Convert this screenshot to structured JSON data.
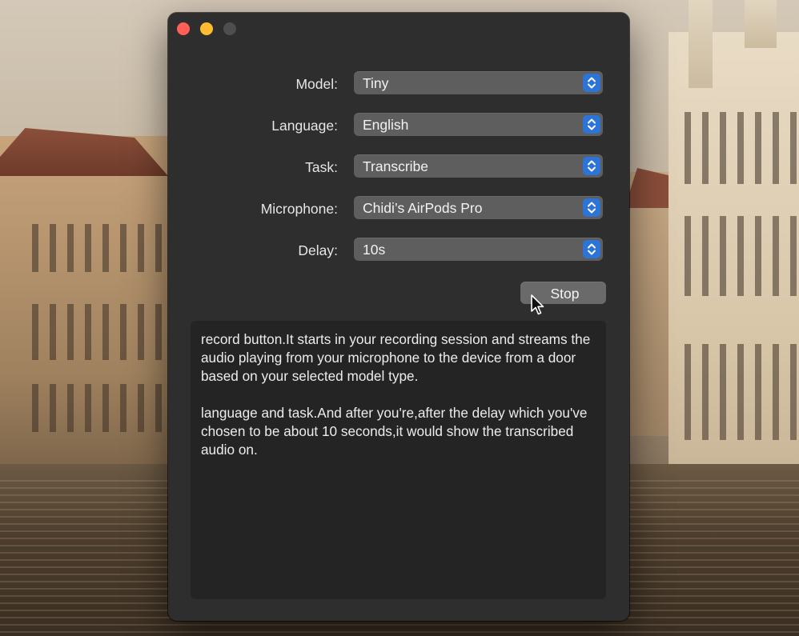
{
  "window": {
    "controls": {
      "close": "close",
      "minimize": "minimize",
      "zoom": "zoom"
    }
  },
  "form": {
    "model": {
      "label": "Model:",
      "value": "Tiny"
    },
    "language": {
      "label": "Language:",
      "value": "English"
    },
    "task": {
      "label": "Task:",
      "value": "Transcribe"
    },
    "microphone": {
      "label": "Microphone:",
      "value": "Chidi’s AirPods Pro"
    },
    "delay": {
      "label": "Delay:",
      "value": "10s"
    }
  },
  "actions": {
    "stop_label": "Stop"
  },
  "transcript": {
    "paragraphs": [
      "record button.It starts in your recording session and streams the audio playing from your microphone to the device from a door based on your selected model type.",
      "language and task.And after you're,after the delay which you've chosen to be about 10 seconds,it would show the transcribed audio on."
    ]
  },
  "colors": {
    "window_bg": "#2e2e2e",
    "popup_bg": "#5e5e5e",
    "accent": "#2d74d9",
    "close": "#ff5f57",
    "minimize": "#febc2e",
    "zoom_disabled": "#4e4e4e",
    "text_area_bg": "#242424"
  },
  "icons": {
    "popup_indicator": "chevron-up-down-icon",
    "pointer": "mouse-pointer-icon"
  }
}
